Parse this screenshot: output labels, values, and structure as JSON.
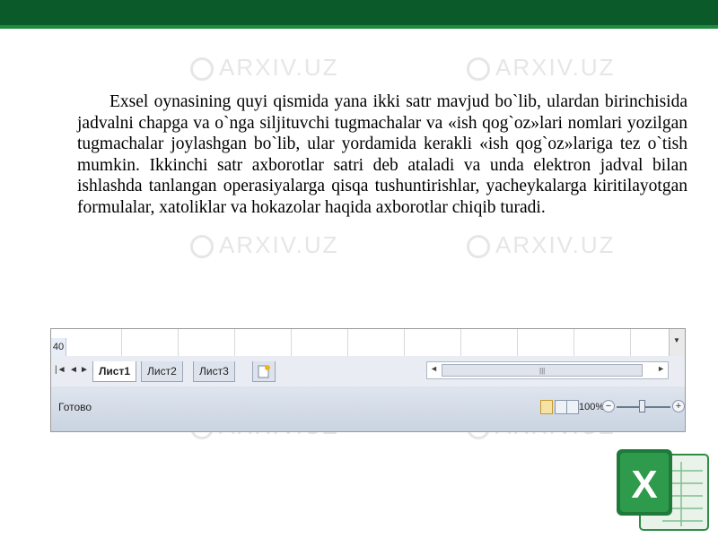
{
  "watermarks": [
    "ARXIV.UZ",
    "ARXIV.UZ",
    "ARXIV.UZ",
    "ARXIV.UZ",
    "ARXIV.UZ",
    "ARXIV.UZ"
  ],
  "paragraph": "Exsel oynasining quyi qismida yana ikki satr mavjud bo`lib, ulardan birinchisida jadvalni chapga va o`nga siljituvchi tugmachalar va «ish qog`oz»lari nomlari yozilgan tugmachalar joylashgan bo`lib, ular yordamida kerakli «ish qog`oz»lariga tez o`tish mumkin. Ikkinchi satr axborotlar satri deb ataladi va unda elektron jadval bilan ishlashda tanlangan operasiyalarga qisqa tushuntirishlar, yacheykalarga kiritilayotgan formulalar, xatoliklar  va hokazolar haqida axborotlar chiqib turadi.",
  "excel": {
    "row_number": "40",
    "sheets": [
      "Лист1",
      "Лист2",
      "Лист3"
    ],
    "active_sheet": 0,
    "status": "Готово",
    "zoom": "100%",
    "zoom_minus": "−",
    "zoom_plus": "+"
  },
  "logo": {
    "letter": "X",
    "color": "#1f7a3a"
  },
  "colors": {
    "header": "#0b5a2a",
    "accent": "#1f8a3f"
  }
}
